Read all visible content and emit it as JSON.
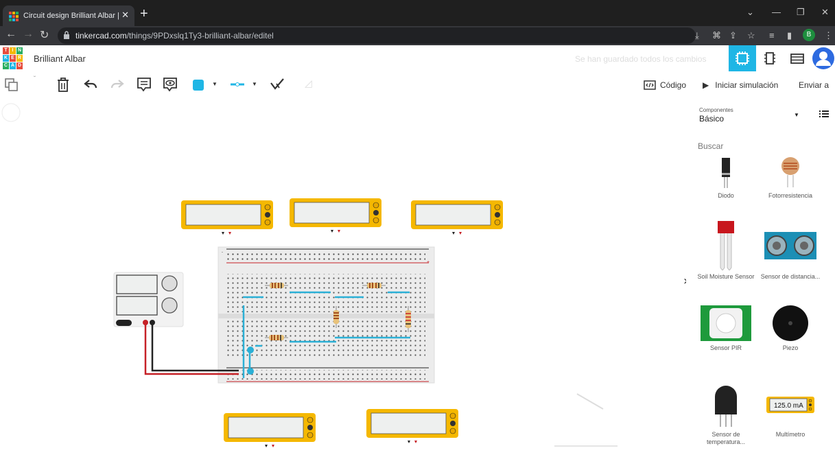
{
  "browser": {
    "tab_title": "Circuit design Brilliant Albar | Tin",
    "url_host": "tinkercad.com",
    "url_path": "/things/9PDxslq1Ty3-brilliant-albar/editel",
    "profile_initial": "B"
  },
  "app": {
    "logo_letters": [
      "T",
      "I",
      "N",
      "K",
      "E",
      "R",
      "C",
      "A",
      "D"
    ],
    "project_name": "Brilliant Albar",
    "save_status": "Se han guardado todos los cambios"
  },
  "toolbar": {
    "code_label": "Código",
    "simulate_label": "Iniciar simulación",
    "send_label": "Enviar a"
  },
  "panel": {
    "components_caption": "Componentes",
    "category": "Básico",
    "search_label": "Buscar",
    "items": [
      {
        "label": "Diodo"
      },
      {
        "label": "Fotorresistencia"
      },
      {
        "label": "Soil Moisture Sensor"
      },
      {
        "label": "Sensor de distancia..."
      },
      {
        "label": "Sensor PIR"
      },
      {
        "label": "Piezo"
      },
      {
        "label": "Sensor de temperatura..."
      },
      {
        "label": "Multímetro"
      }
    ],
    "multimeter_reading": "125.0 mA"
  },
  "colors": {
    "accent": "#1fb6e5",
    "meter_yellow": "#f5b800",
    "wire_red": "#c62026",
    "wire_black": "#222222",
    "wire_blue": "#2bb0d6"
  }
}
